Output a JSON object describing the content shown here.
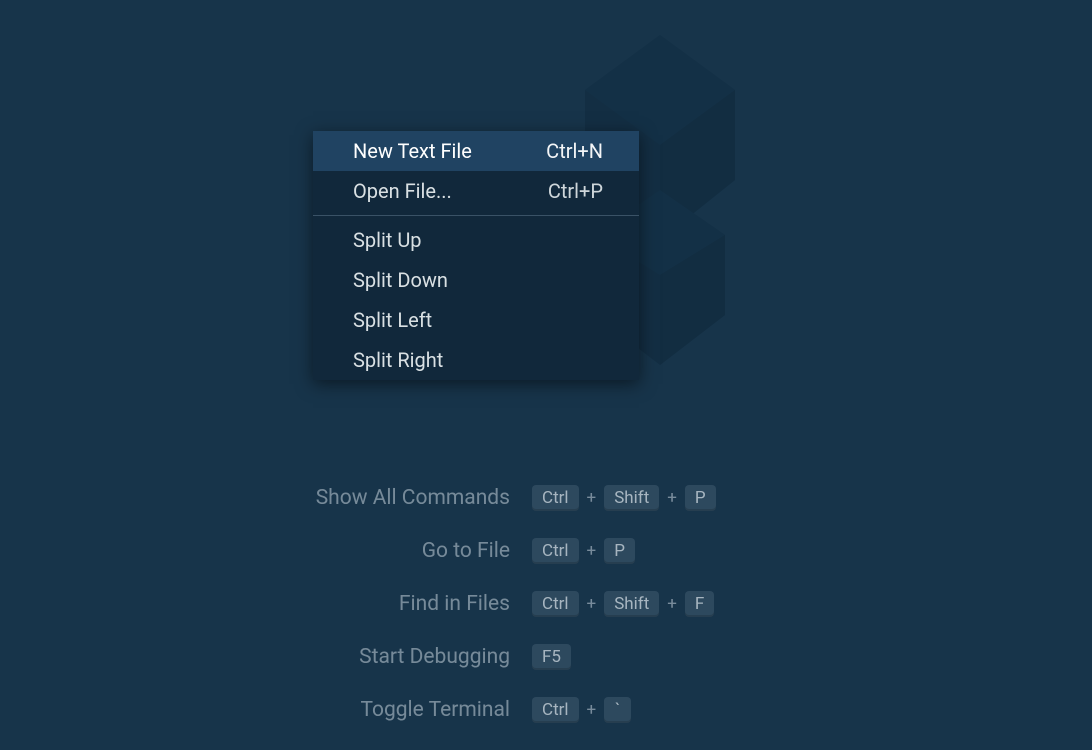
{
  "context_menu": {
    "items": [
      {
        "label": "New Text File",
        "shortcut": "Ctrl+N",
        "highlighted": true
      },
      {
        "label": "Open File...",
        "shortcut": "Ctrl+P",
        "highlighted": false
      },
      {
        "separator": true
      },
      {
        "label": "Split Up",
        "shortcut": "",
        "highlighted": false
      },
      {
        "label": "Split Down",
        "shortcut": "",
        "highlighted": false
      },
      {
        "label": "Split Left",
        "shortcut": "",
        "highlighted": false
      },
      {
        "label": "Split Right",
        "shortcut": "",
        "highlighted": false
      }
    ]
  },
  "shortcuts": [
    {
      "label": "Show All Commands",
      "keys": [
        "Ctrl",
        "Shift",
        "P"
      ]
    },
    {
      "label": "Go to File",
      "keys": [
        "Ctrl",
        "P"
      ]
    },
    {
      "label": "Find in Files",
      "keys": [
        "Ctrl",
        "Shift",
        "F"
      ]
    },
    {
      "label": "Start Debugging",
      "keys": [
        "F5"
      ]
    },
    {
      "label": "Toggle Terminal",
      "keys": [
        "Ctrl",
        "`"
      ]
    }
  ],
  "plus_separator": "+"
}
